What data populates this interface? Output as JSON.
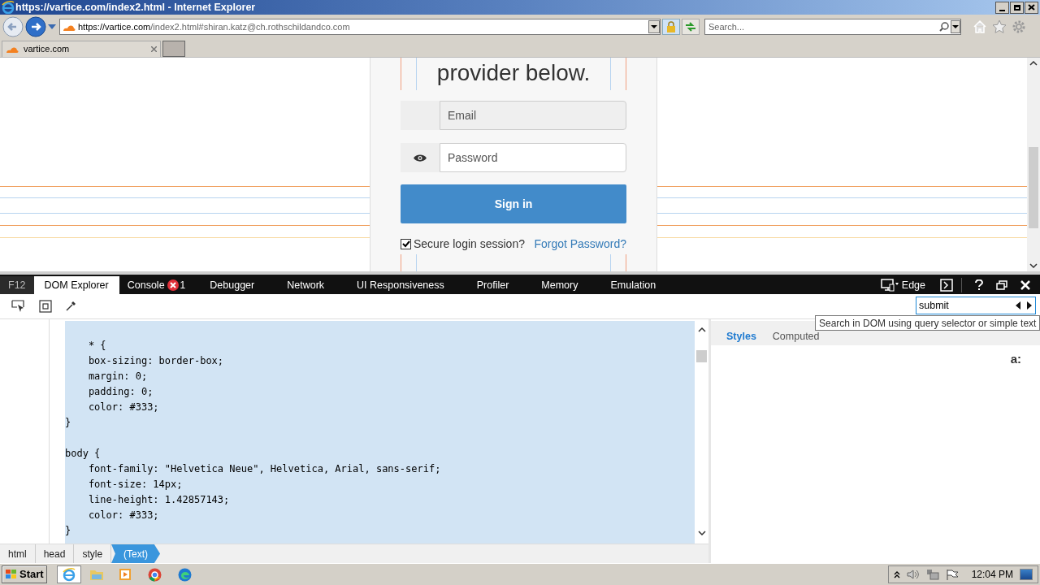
{
  "window": {
    "title": "https://vartice.com/index2.html - Internet Explorer"
  },
  "address_bar": {
    "host": "https://vartice.com",
    "path": "/index2.html#shiran.katz@ch.rothschildandco.com"
  },
  "search": {
    "placeholder": "Search..."
  },
  "browser_tabs": [
    {
      "label": "vartice.com",
      "selected": true
    }
  ],
  "page": {
    "heading": "provider below.",
    "email": {
      "placeholder": "Email"
    },
    "password": {
      "placeholder": "Password"
    },
    "button": "Sign in",
    "secure": {
      "label": "Secure login session?",
      "checked": true
    },
    "forgot_link": "Forgot Password?"
  },
  "devtools": {
    "f12": "F12",
    "tabs": [
      {
        "label": "DOM Explorer",
        "selected": true
      },
      {
        "label": "Console",
        "selected": false,
        "errors": "1"
      },
      {
        "label": "Debugger",
        "selected": false
      },
      {
        "label": "Network",
        "selected": false
      },
      {
        "label": "UI Responsiveness",
        "selected": false
      },
      {
        "label": "Profiler",
        "selected": false
      },
      {
        "label": "Memory",
        "selected": false
      },
      {
        "label": "Emulation",
        "selected": false
      }
    ],
    "mode": "Edge",
    "dom_search": {
      "value": "submit",
      "tooltip": "Search in DOM using query selector or simple text"
    },
    "code_blocks": [
      [
        "    * {",
        "    box-sizing: border-box;",
        "    margin: 0;",
        "    padding: 0;",
        "    color: #333;",
        "}"
      ],
      [
        "body {",
        "    font-family: \"Helvetica Neue\", Helvetica, Arial, sans-serif;",
        "    font-size: 14px;",
        "    line-height: 1.42857143;",
        "    color: #333;",
        "}"
      ]
    ],
    "style_tabs": [
      {
        "label": "Styles",
        "selected": true
      },
      {
        "label": "Computed",
        "selected": false
      }
    ],
    "pseudo_toggle": "a:",
    "breadcrumb": [
      {
        "label": "html",
        "selected": false
      },
      {
        "label": "head",
        "selected": false
      },
      {
        "label": "style",
        "selected": false
      },
      {
        "label": "(Text)",
        "selected": true
      }
    ]
  },
  "taskbar": {
    "start": "Start",
    "time": "12:04 PM"
  }
}
